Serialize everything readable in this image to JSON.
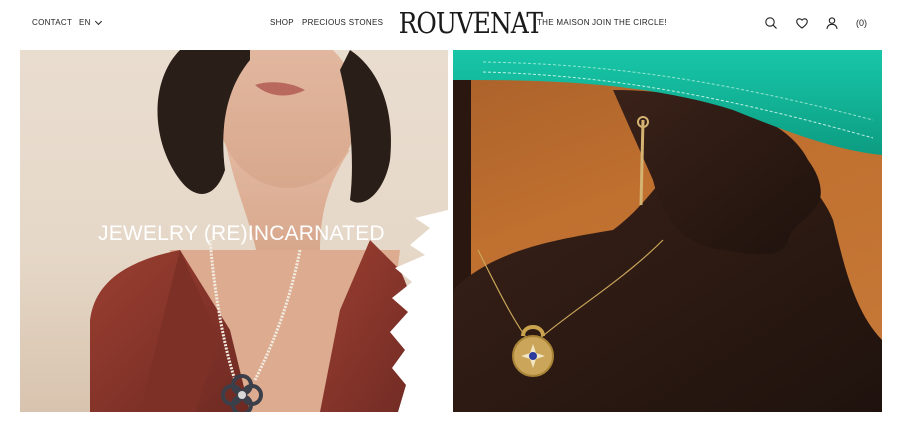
{
  "nav": {
    "left": [
      "CONTACT",
      "EN"
    ],
    "center_left": [
      "SHOP",
      "PRECIOUS STONES"
    ],
    "center_right": [
      "THE MAISON",
      "JOIN THE CIRCLE!"
    ]
  },
  "brand": {
    "logo_text": "ROUVENAT"
  },
  "icons": {
    "search": "search-icon",
    "wishlist": "heart-icon",
    "account": "user-icon",
    "language": "chevron-down-icon"
  },
  "cart": {
    "count_label": "(0)"
  },
  "hero": {
    "headline": "JEWELRY (RE)INCARNATED"
  },
  "colors": {
    "background": "#ffffff",
    "text": "#1a1a1a",
    "hat_green": "#12b69a",
    "right_backdrop": "#c0702f",
    "blazer": "#8a3528",
    "gold": "#c9a34e",
    "stone_blue": "#2b3a9c"
  }
}
